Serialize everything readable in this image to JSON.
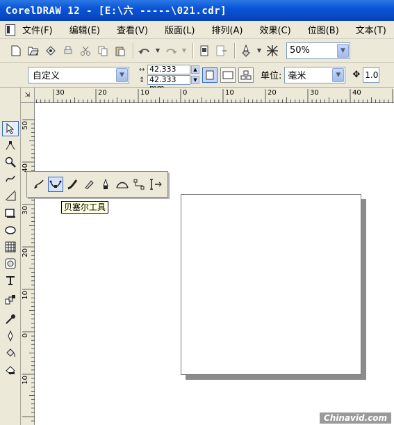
{
  "window": {
    "title": "CorelDRAW 12 - [E:\\六  -----\\021.cdr]"
  },
  "menu": [
    {
      "label": "文件(F)"
    },
    {
      "label": "编辑(E)"
    },
    {
      "label": "查看(V)"
    },
    {
      "label": "版面(L)"
    },
    {
      "label": "排列(A)"
    },
    {
      "label": "效果(C)"
    },
    {
      "label": "位图(B)"
    },
    {
      "label": "文本(T)"
    }
  ],
  "toolbar": {
    "zoom_value": "50%"
  },
  "property_bar": {
    "paper_type": "自定义",
    "width": "42.333 mm",
    "height": "42.333 mm",
    "units_label": "单位:",
    "units_value": "毫米",
    "nudge_value": "1.0"
  },
  "rulers": {
    "horizontal_ticks": [
      "30",
      "20",
      "10",
      "0",
      "10",
      "20",
      "30",
      "40"
    ],
    "vertical_ticks": [
      "50",
      "40",
      "30",
      "20",
      "10",
      "0",
      "10"
    ]
  },
  "flyout": {
    "tooltip": "贝塞尔工具"
  },
  "watermark": "Chinavid.com"
}
